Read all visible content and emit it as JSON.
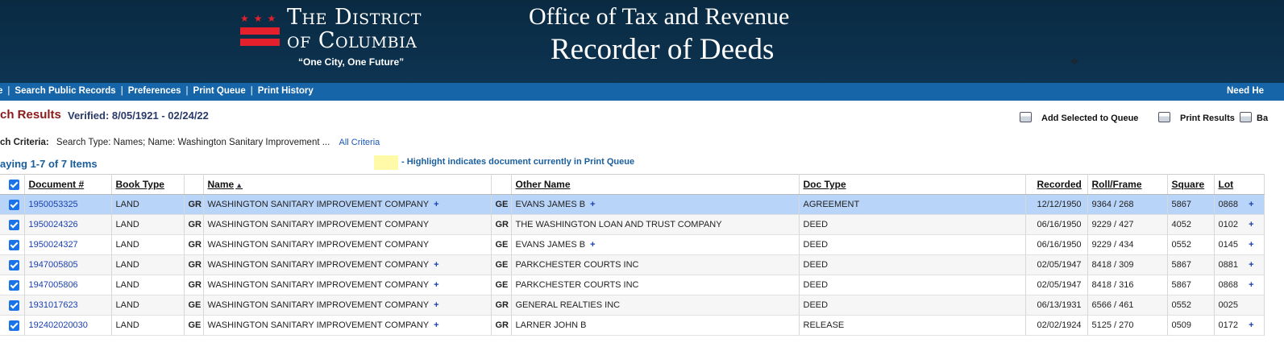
{
  "header": {
    "dc_line1": "The District",
    "dc_line2": "of Columbia",
    "dc_motto": "“One City, One Future”",
    "office_title": "Office of Tax and Revenue",
    "office_subtitle": "Recorder of Deeds"
  },
  "nav": {
    "items": [
      "e",
      "Search Public Records",
      "Preferences",
      "Print Queue",
      "Print History"
    ],
    "help": "Need He"
  },
  "results": {
    "title": "ch Results",
    "verified": "Verified: 8/05/1921 - 02/24/22",
    "add_to_queue": "Add Selected to Queue",
    "print_results": "Print Results",
    "back": "Ba",
    "criteria_label": "ch Criteria:",
    "criteria_value": "Search Type: Names; Name: Washington Sanitary Improvement ...",
    "all_criteria": "All Criteria",
    "displaying": "aying 1-7 of 7 Items",
    "highlight_note": "- Highlight indicates document currently in Print Queue"
  },
  "table": {
    "columns": [
      "Document #",
      "Book Type",
      "",
      "Name",
      "",
      "Other Name",
      "Doc Type",
      "Recorded",
      "Roll/Frame",
      "Square",
      "Lot"
    ],
    "rows": [
      {
        "doc": "1950053325",
        "book": "LAND",
        "role1": "GR",
        "name": "WASHINGTON SANITARY IMPROVEMENT COMPANY",
        "name_plus": true,
        "role2": "GE",
        "other": "EVANS JAMES B",
        "other_plus": true,
        "doctype": "AGREEMENT",
        "recorded": "12/12/1950",
        "roll": "9364 / 268",
        "square": "5867",
        "lot": "0868",
        "lot_plus": true
      },
      {
        "doc": "1950024326",
        "book": "LAND",
        "role1": "GR",
        "name": "WASHINGTON SANITARY IMPROVEMENT COMPANY",
        "name_plus": false,
        "role2": "GR",
        "other": "THE WASHINGTON LOAN AND TRUST COMPANY",
        "other_plus": false,
        "doctype": "DEED",
        "recorded": "06/16/1950",
        "roll": "9229 / 427",
        "square": "4052",
        "lot": "0102",
        "lot_plus": true
      },
      {
        "doc": "1950024327",
        "book": "LAND",
        "role1": "GR",
        "name": "WASHINGTON SANITARY IMPROVEMENT COMPANY",
        "name_plus": false,
        "role2": "GE",
        "other": "EVANS JAMES B",
        "other_plus": true,
        "doctype": "DEED",
        "recorded": "06/16/1950",
        "roll": "9229 / 434",
        "square": "0552",
        "lot": "0145",
        "lot_plus": true
      },
      {
        "doc": "1947005805",
        "book": "LAND",
        "role1": "GR",
        "name": "WASHINGTON SANITARY IMPROVEMENT COMPANY",
        "name_plus": true,
        "role2": "GE",
        "other": "PARKCHESTER COURTS INC",
        "other_plus": false,
        "doctype": "DEED",
        "recorded": "02/05/1947",
        "roll": "8418 / 309",
        "square": "5867",
        "lot": "0881",
        "lot_plus": true
      },
      {
        "doc": "1947005806",
        "book": "LAND",
        "role1": "GR",
        "name": "WASHINGTON SANITARY IMPROVEMENT COMPANY",
        "name_plus": true,
        "role2": "GE",
        "other": "PARKCHESTER COURTS INC",
        "other_plus": false,
        "doctype": "DEED",
        "recorded": "02/05/1947",
        "roll": "8418 / 316",
        "square": "5867",
        "lot": "0868",
        "lot_plus": true
      },
      {
        "doc": "1931017623",
        "book": "LAND",
        "role1": "GE",
        "name": "WASHINGTON SANITARY IMPROVEMENT COMPANY",
        "name_plus": true,
        "role2": "GR",
        "other": "GENERAL REALTIES INC",
        "other_plus": false,
        "doctype": "DEED",
        "recorded": "06/13/1931",
        "roll": "6566 / 461",
        "square": "0552",
        "lot": "0025",
        "lot_plus": false
      },
      {
        "doc": "192402020030",
        "book": "LAND",
        "role1": "GE",
        "name": "WASHINGTON SANITARY IMPROVEMENT COMPANY",
        "name_plus": true,
        "role2": "GR",
        "other": "LARNER JOHN B",
        "other_plus": false,
        "doctype": "RELEASE",
        "recorded": "02/02/1924",
        "roll": "5125 / 270",
        "square": "0509",
        "lot": "0172",
        "lot_plus": true
      }
    ]
  },
  "colors": {
    "banner": "#0b2e49",
    "nav": "#1565a8",
    "selected_row": "#b8d4f8",
    "highlight": "#fffaa8",
    "title": "#8b1a1a",
    "link": "#1a3fb0"
  }
}
